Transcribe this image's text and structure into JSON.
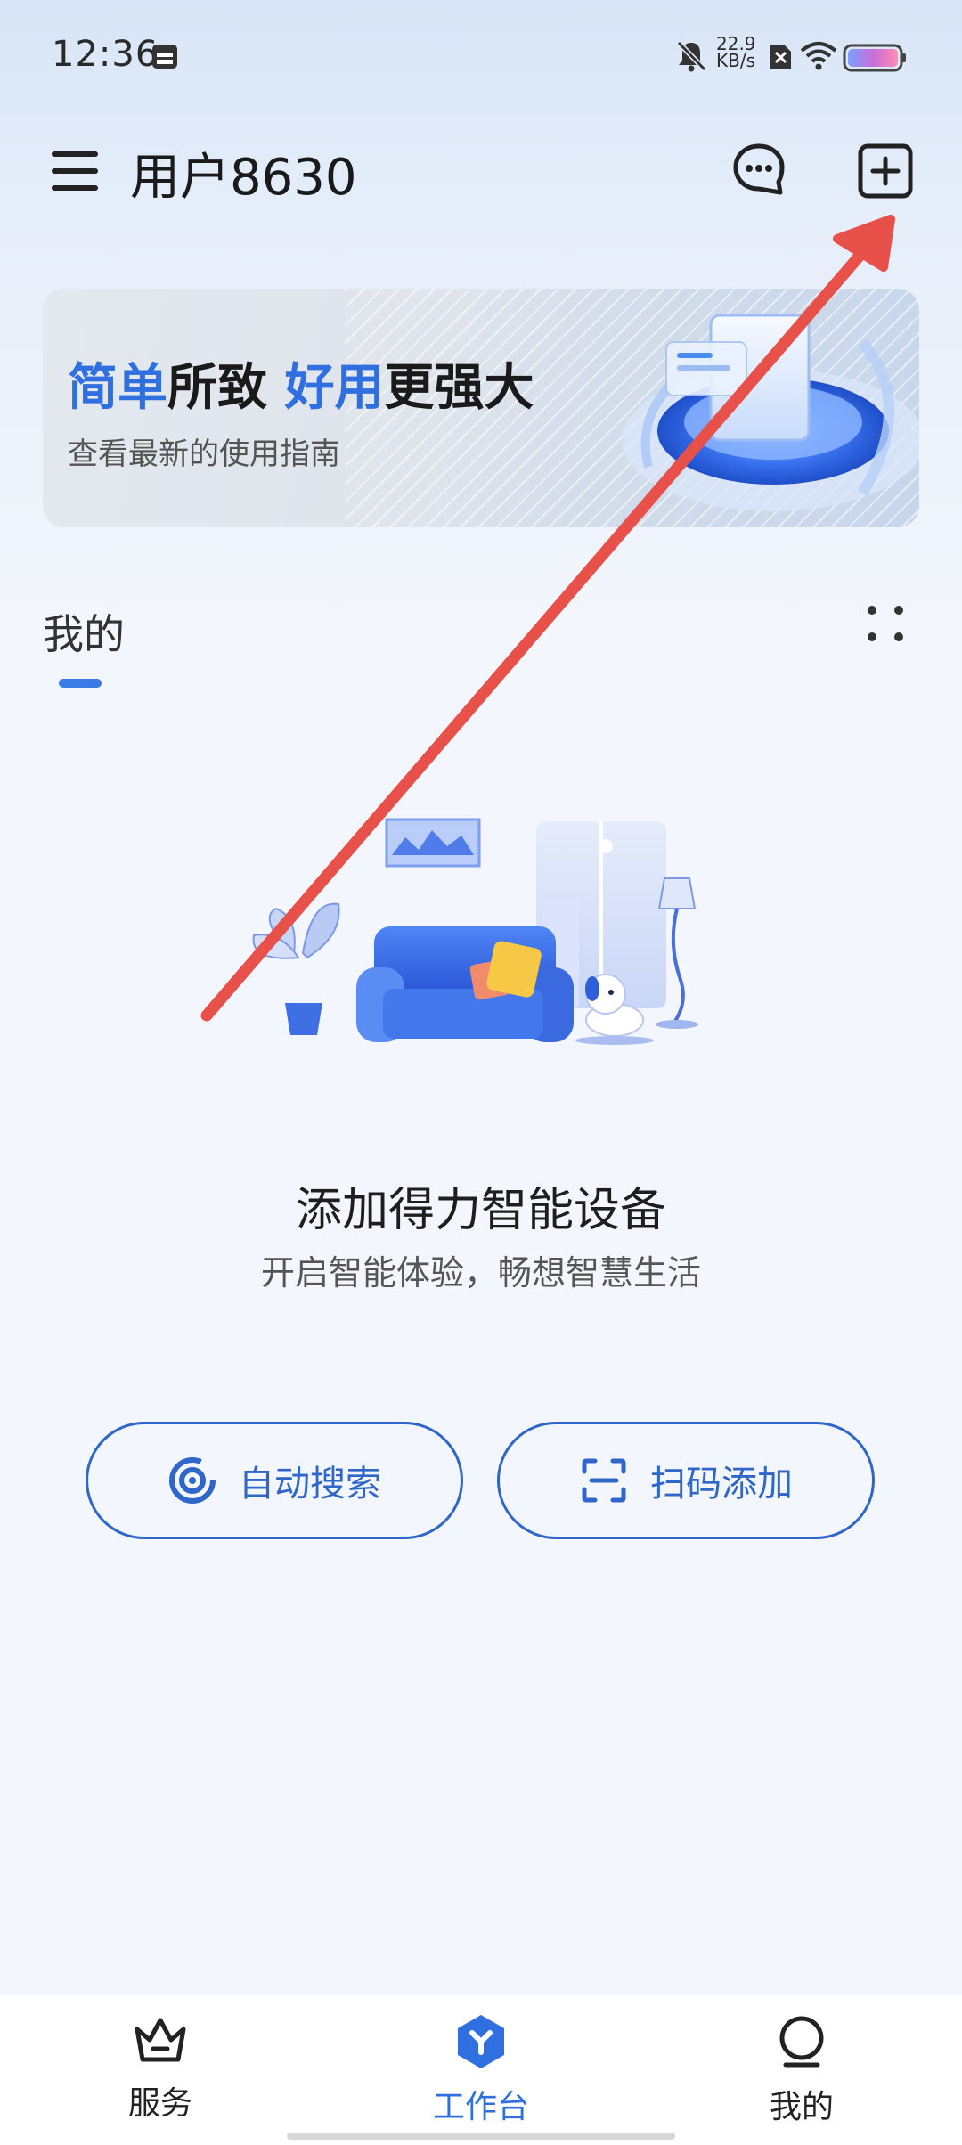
{
  "status_bar": {
    "time": "12:36",
    "net_speed_value": "22.9",
    "net_speed_unit": "KB/s",
    "icons": [
      "calendar-icon",
      "mute-icon",
      "sim-off-icon",
      "wifi-icon",
      "battery-icon"
    ]
  },
  "header": {
    "username": "用户8630",
    "icons": [
      "menu-icon",
      "message-icon",
      "add-icon"
    ]
  },
  "banner": {
    "title_part1": "简单",
    "title_part2": "所致 ",
    "title_part3": "好用",
    "title_part4": "更强大",
    "subtitle": "查看最新的使用指南"
  },
  "section": {
    "title": "我的"
  },
  "empty_state": {
    "title": "添加得力智能设备",
    "subtitle": "开启智能体验，畅想智慧生活"
  },
  "actions": {
    "auto_search": "自动搜索",
    "scan_add": "扫码添加"
  },
  "bottom_nav": {
    "items": [
      {
        "label": "服务",
        "icon": "crown-icon",
        "active": false
      },
      {
        "label": "工作台",
        "icon": "workbench-icon",
        "active": true
      },
      {
        "label": "我的",
        "icon": "profile-icon",
        "active": false
      }
    ]
  },
  "colors": {
    "accent": "#2f6fe0",
    "button_border": "#2e66c9",
    "annotation_arrow": "#e8504a"
  }
}
